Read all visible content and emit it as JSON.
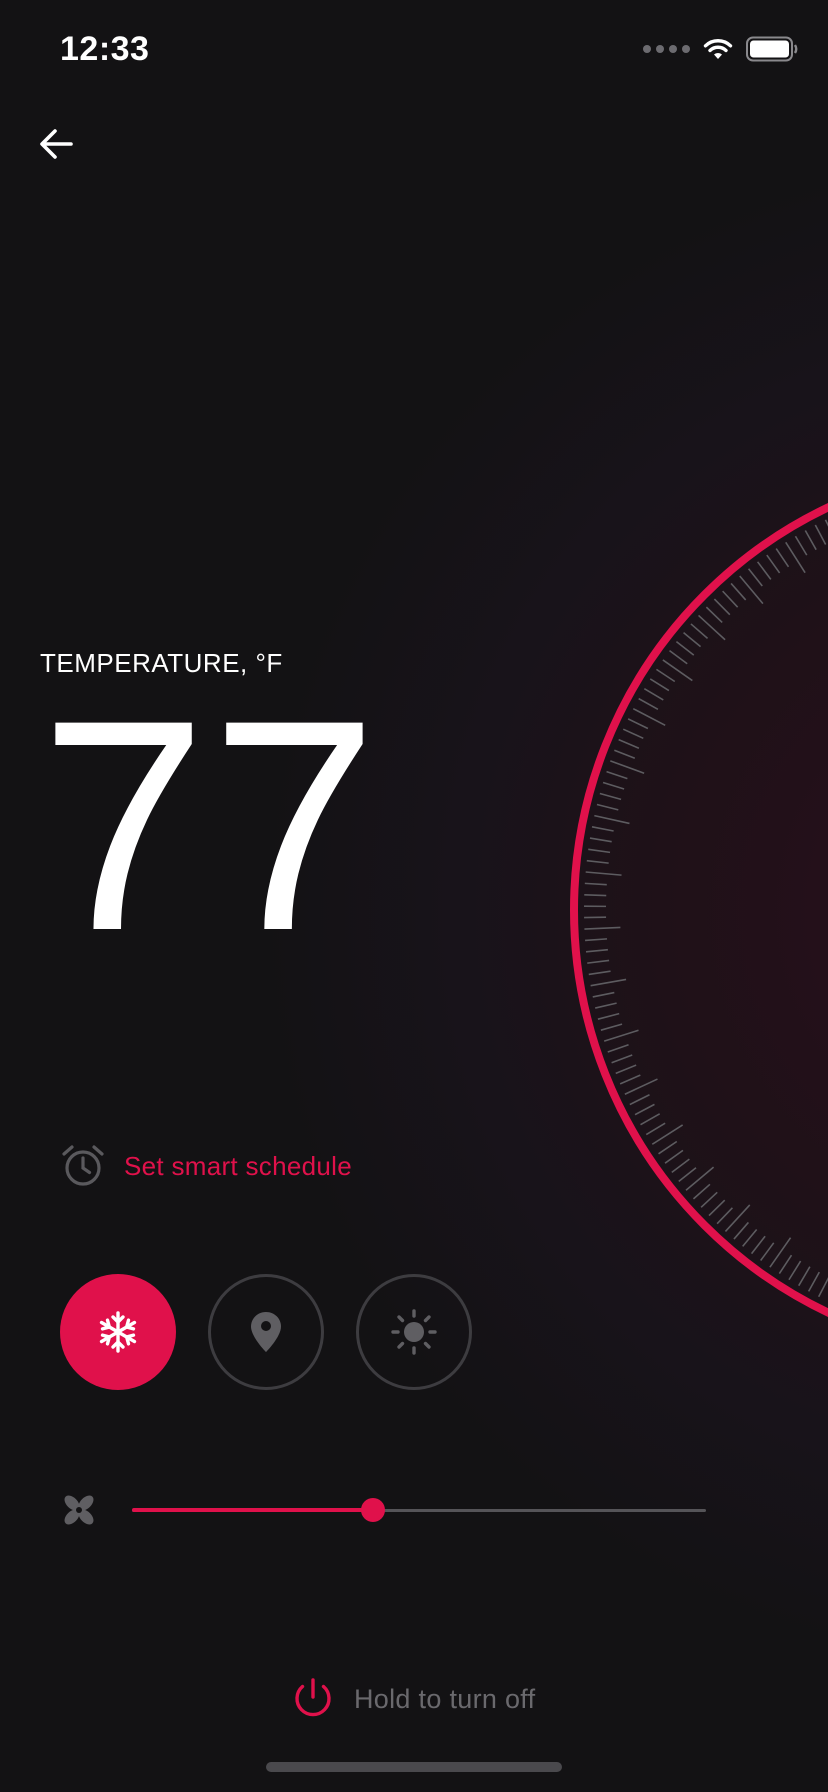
{
  "status_bar": {
    "time": "12:33",
    "icons": [
      "cellular-signal-icon",
      "wifi-icon",
      "battery-icon"
    ]
  },
  "nav": {
    "back_icon": "arrow-left-icon"
  },
  "thermostat": {
    "label": "TEMPERATURE, °F",
    "value": "77"
  },
  "schedule": {
    "icon": "alarm-clock-icon",
    "label": "Set smart schedule"
  },
  "modes": [
    {
      "name": "cool",
      "icon": "snowflake-icon",
      "active": true
    },
    {
      "name": "location",
      "icon": "location-pin-icon",
      "active": false
    },
    {
      "name": "sun",
      "icon": "sun-icon",
      "active": false
    }
  ],
  "fan": {
    "icon": "fan-icon",
    "level": 0.42
  },
  "power": {
    "icon": "power-icon",
    "label": "Hold to turn off"
  },
  "colors": {
    "background": "#131214",
    "accent": "#e0114b",
    "muted": "#6a696d",
    "tick": "#5d5c60"
  }
}
